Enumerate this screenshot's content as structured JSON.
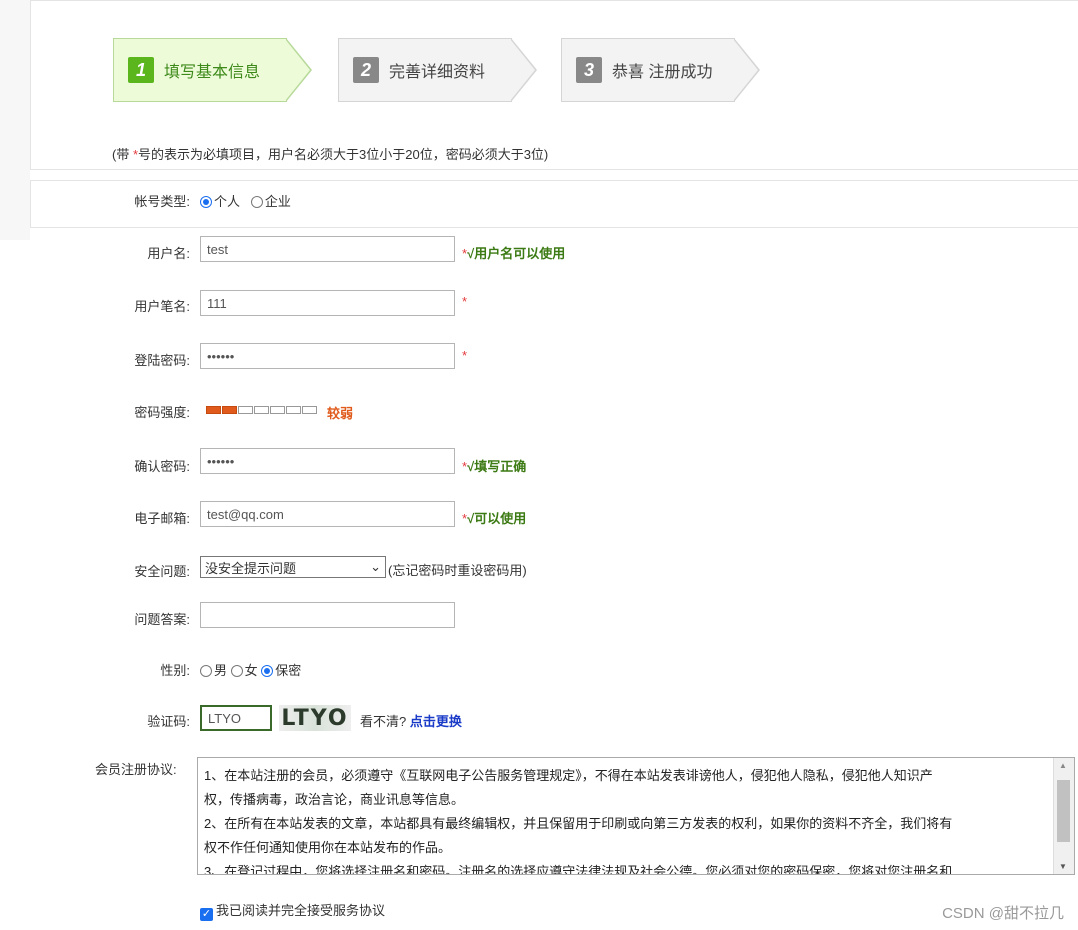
{
  "steps": [
    {
      "num": "1",
      "label": "填写基本信息"
    },
    {
      "num": "2",
      "label": "完善详细资料"
    },
    {
      "num": "3",
      "label": "恭喜 注册成功"
    }
  ],
  "note": {
    "prefix": "(带 ",
    "star": "*",
    "suffix": "号的表示为必填项目，用户名必须大于3位小于20位，密码必须大于3位)"
  },
  "account_type": {
    "label": "帐号类型:",
    "options": [
      "个人",
      "企业"
    ],
    "selected": "个人"
  },
  "form": {
    "username": {
      "label": "用户名:",
      "value": "test",
      "status": "√用户名可以使用"
    },
    "nickname": {
      "label": "用户笔名:",
      "value": "111"
    },
    "password": {
      "label": "登陆密码:",
      "value": "••••••"
    },
    "strength": {
      "label": "密码强度:",
      "level_text": "较弱",
      "filled": 2,
      "total": 7
    },
    "confirm": {
      "label": "确认密码:",
      "value": "••••••",
      "status": "√填写正确"
    },
    "email": {
      "label": "电子邮箱:",
      "value": "test@qq.com",
      "status": "√可以使用"
    },
    "question": {
      "label": "安全问题:",
      "selected": "没安全提示问题",
      "hint": "(忘记密码时重设密码用)"
    },
    "answer": {
      "label": "问题答案:",
      "value": ""
    },
    "gender": {
      "label": "性别:",
      "options": [
        "男",
        "女",
        "保密"
      ],
      "selected": "保密"
    },
    "captcha": {
      "label": "验证码:",
      "value": "LTYO",
      "image_text": "LTYO",
      "unclear": "看不清?",
      "refresh": "点击更换"
    }
  },
  "star": "*",
  "agreement": {
    "label": "会员注册协议:",
    "lines": [
      "1、在本站注册的会员，必须遵守《互联网电子公告服务管理规定》，不得在本站发表诽谤他人，侵犯他人隐私，侵犯他人知识产",
      "权，传播病毒，政治言论，商业讯息等信息。",
      "2、在所有在本站发表的文章，本站都具有最终编辑权，并且保留用于印刷或向第三方发表的权利，如果你的资料不齐全，我们将有",
      "权不作任何通知使用你在本站发布的作品。",
      "3、在登记过程中，您将选择注册名和密码。注册名的选择应遵守法律法规及社会公德。您必须对您的密码保密，您将对您注册名和"
    ],
    "checkbox_label": "我已阅读并完全接受服务协议"
  },
  "watermark": "CSDN @甜不拉几"
}
